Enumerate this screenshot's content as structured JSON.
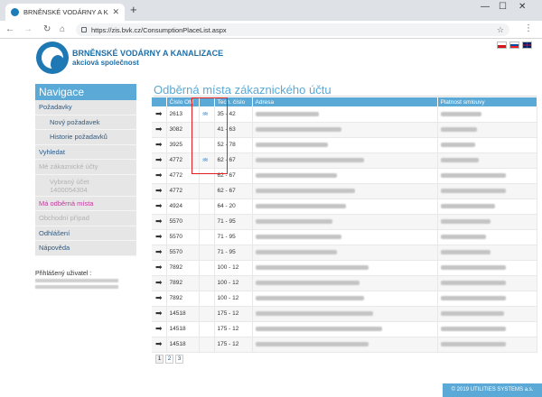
{
  "browser": {
    "tab_title": "BRNĚNSKÉ VODÁRNY A KANALIZ",
    "url": "https://zis.bvk.cz/ConsumptionPlaceList.aspx"
  },
  "site": {
    "brand_line1": "BRNĚNSKÉ VODÁRNY A KANALIZACE",
    "brand_line2": "akciová společnost"
  },
  "sidebar": {
    "title": "Navigace",
    "items": [
      {
        "label": "Požadavky"
      },
      {
        "label": "Nový požadavek"
      },
      {
        "label": "Historie požadavků"
      },
      {
        "label": "Vyhledat"
      },
      {
        "label": "Mé zákaznické účty"
      },
      {
        "label": "Vybraný účet"
      },
      {
        "label": "1400054304"
      },
      {
        "label": "Má odběrná místa"
      },
      {
        "label": "Obchodní případ"
      },
      {
        "label": "Odhlášení"
      },
      {
        "label": "Nápověda"
      }
    ],
    "login_label": "Přihlášený uživatel :"
  },
  "main": {
    "title": "Odběrná místa zákaznického účtu",
    "columns": [
      "Číslo OM",
      "Tech. číslo",
      "Adresa",
      "Platnost smlouvy"
    ],
    "rows": [
      {
        "om": "2613",
        "tech": "35 - 42",
        "icon": true
      },
      {
        "om": "3082",
        "tech": "41 - 63",
        "icon": false
      },
      {
        "om": "3925",
        "tech": "52 - 78",
        "icon": false
      },
      {
        "om": "4772",
        "tech": "62 - 67",
        "icon": true
      },
      {
        "om": "4772",
        "tech": "62 - 67",
        "icon": false
      },
      {
        "om": "4772",
        "tech": "62 - 67",
        "icon": false
      },
      {
        "om": "4924",
        "tech": "64 - 20",
        "icon": false
      },
      {
        "om": "5570",
        "tech": "71 - 95",
        "icon": false
      },
      {
        "om": "5570",
        "tech": "71 - 95",
        "icon": false
      },
      {
        "om": "5570",
        "tech": "71 - 95",
        "icon": false
      },
      {
        "om": "7892",
        "tech": "100 - 12",
        "icon": false
      },
      {
        "om": "7892",
        "tech": "100 - 12",
        "icon": false
      },
      {
        "om": "7892",
        "tech": "100 - 12",
        "icon": false
      },
      {
        "om": "14518",
        "tech": "175 - 12",
        "icon": false
      },
      {
        "om": "14518",
        "tech": "175 - 12",
        "icon": false
      },
      {
        "om": "14518",
        "tech": "175 - 12",
        "icon": false
      }
    ],
    "pages": [
      "1",
      "2",
      "3"
    ]
  },
  "footer": {
    "text": "© 2019 UTILITIES SYSTEMS a.s."
  },
  "colors": {
    "accent": "#5aa9d6",
    "brand": "#1d6fa8",
    "highlight": "#e02020",
    "active_item": "#c0399b"
  }
}
